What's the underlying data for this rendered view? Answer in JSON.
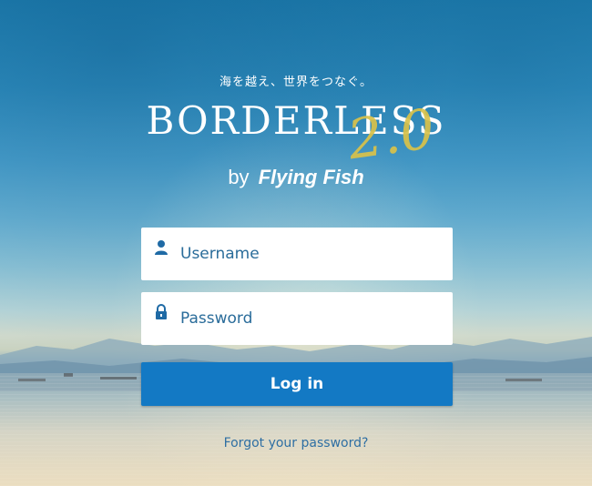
{
  "branding": {
    "tagline": "海を越え、世界をつなぐ。",
    "logo_main": "BORDERLESS",
    "logo_version": "2.0",
    "logo_by": "by",
    "logo_brand": "Flying Fish"
  },
  "form": {
    "username_placeholder": "Username",
    "password_placeholder": "Password",
    "login_label": "Log in",
    "forgot_label": "Forgot your password?"
  },
  "icons": {
    "username": "user-icon",
    "password": "lock-icon"
  },
  "colors": {
    "accent": "#1379c4",
    "link": "#2f6fa3",
    "logo_version": "#d9c24a"
  }
}
